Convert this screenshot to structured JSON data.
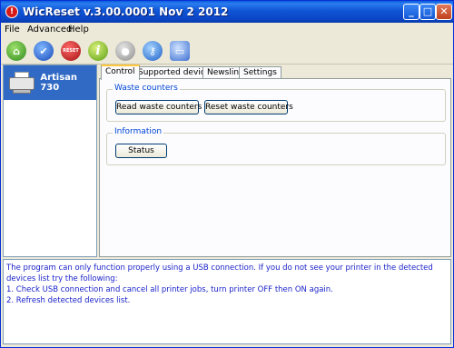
{
  "window": {
    "title": "WicReset v.3.00.0001 Nov  2 2012"
  },
  "menu": [
    "File",
    "Advanced",
    "Help"
  ],
  "toolbar": {
    "reset_label": "RESET"
  },
  "devices": [
    {
      "label": "Artisan 730"
    }
  ],
  "tabs": [
    "Control",
    "Supported devices",
    "Newsline",
    "Settings"
  ],
  "active_tab": "Control",
  "groups": {
    "waste": {
      "title": "Waste counters",
      "read_button": "Read waste counters",
      "reset_button": "Reset waste counters"
    },
    "info": {
      "title": "Information",
      "status_button": "Status"
    }
  },
  "message": {
    "line1": "The program can only function properly using a USB connection. If you do not see your printer in the detected devices list try the following:",
    "line2": "1. Check USB connection and cancel all printer jobs, turn printer OFF then ON again.",
    "line3": "2. Refresh detected devices list."
  },
  "colors": {
    "titlebar": "#0a47c8",
    "selection": "#316ac5",
    "message_text": "#1a23c8",
    "group_title": "#0046d5"
  }
}
